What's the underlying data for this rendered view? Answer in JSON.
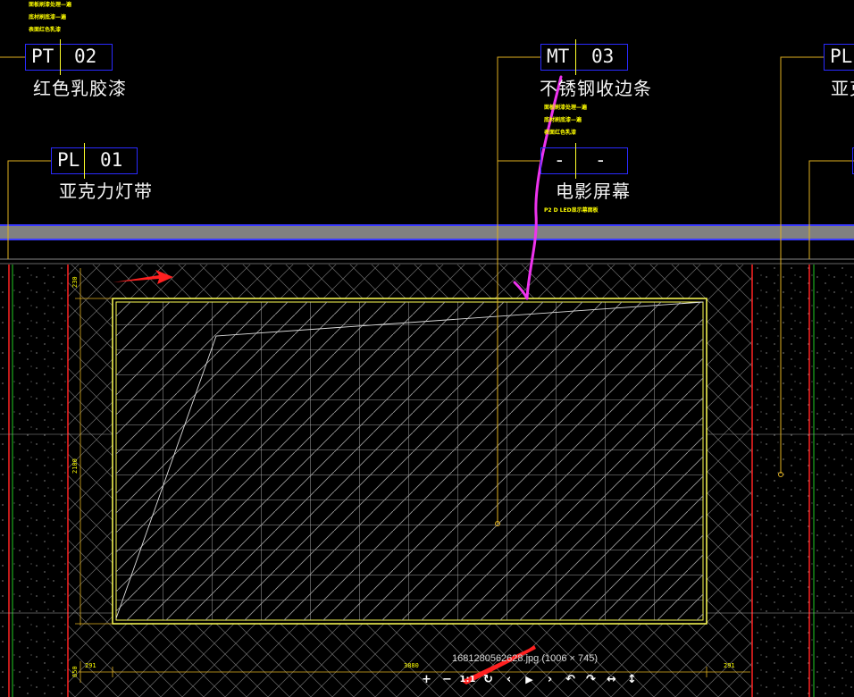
{
  "labels": [
    {
      "id": "pt02",
      "code": "PT",
      "num": "02",
      "name": "红色乳胶漆"
    },
    {
      "id": "pl01",
      "code": "PL",
      "num": "01",
      "name": "亚克力灯带"
    },
    {
      "id": "mt03",
      "code": "MT",
      "num": "03",
      "name": "不锈钢收边条"
    },
    {
      "id": "dash",
      "code": "-",
      "num": "-",
      "name": "电影屏幕"
    },
    {
      "id": "pl_right",
      "code": "PL",
      "num": "",
      "name": "亚克"
    }
  ],
  "tiny_notes": {
    "left": [
      "面板刷漆处理—遍",
      "底材刷底漆—遍",
      "表面红色乳漆"
    ],
    "mid": [
      "面板刷漆处理—遍",
      "底材刷底漆—遍",
      "表面红色乳漆"
    ],
    "screen": "P2 D LED显示幕面板"
  },
  "dimensions": {
    "top_offset": "230",
    "height": "2100",
    "bottom_offset": "650",
    "left_width": "291",
    "main_width": "3880",
    "right_width": "291"
  },
  "viewer": {
    "caption": "1681280562628.jpg (1006 × 745)",
    "toolbar": [
      "+",
      "−",
      "1:1",
      "↻",
      "‹",
      "▶",
      "›",
      "↶",
      "↷",
      "↔",
      "↕"
    ]
  },
  "colors": {
    "background": "#000000",
    "tag_border": "#2a2aff",
    "leader": "#e0b020",
    "band": "#808080",
    "frame": "#ffff55",
    "annotation_pink": "#ee33ee",
    "annotation_red": "#ff2222"
  }
}
